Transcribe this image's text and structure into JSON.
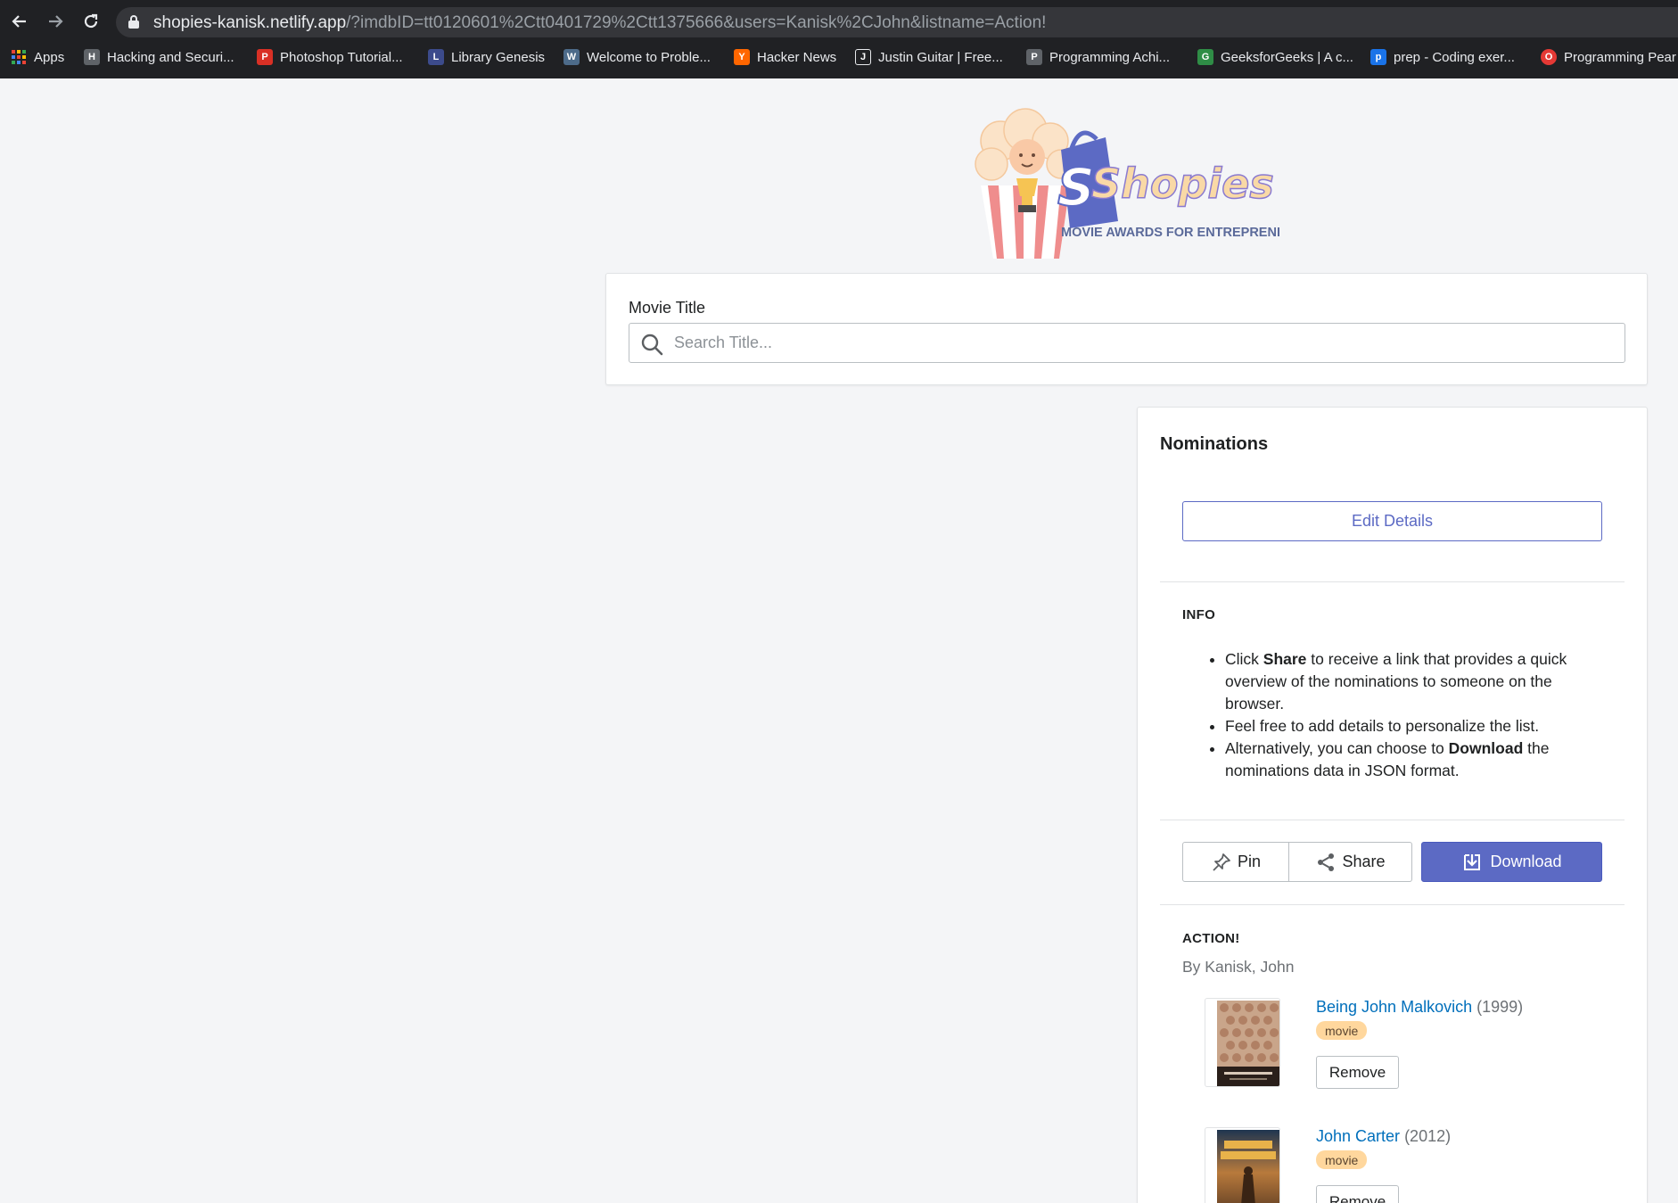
{
  "browser": {
    "url_host": "shopies-kanisk.netlify.app",
    "url_rest": "/?imdbID=tt0120601%2Ctt0401729%2Ctt1375666&users=Kanisk%2CJohn&listname=Action!",
    "back_icon": "arrow-left-icon",
    "forward_icon": "arrow-right-icon",
    "reload_icon": "reload-icon",
    "bookmarks": [
      {
        "label": "Apps",
        "color": "#ea4335"
      },
      {
        "label": "Hacking and Securi...",
        "color": "#5f6368"
      },
      {
        "label": "Photoshop Tutorial...",
        "color": "#d93025"
      },
      {
        "label": "Library Genesis",
        "color": "#3c4b8c"
      },
      {
        "label": "Welcome to Proble...",
        "color": "#4d6b8a"
      },
      {
        "label": "Hacker News",
        "color": "#ff6600"
      },
      {
        "label": "Justin Guitar | Free...",
        "color": "#202124"
      },
      {
        "label": "Programming Achi...",
        "color": "#5f6368"
      },
      {
        "label": "GeeksforGeeks | A c...",
        "color": "#2f8d46"
      },
      {
        "label": "prep - Coding exer...",
        "color": "#1a73e8"
      },
      {
        "label": "Programming Pear",
        "color": "#e53935"
      }
    ]
  },
  "logo": {
    "brand": "Shopies",
    "tagline": "MOVIE AWARDS FOR ENTREPRENEURS"
  },
  "search": {
    "label": "Movie Title",
    "placeholder": "Search Title...",
    "value": ""
  },
  "nominations": {
    "title": "Nominations",
    "edit_label": "Edit Details",
    "info_heading": "INFO",
    "info_items": [
      {
        "pre": "Click ",
        "bold": "Share",
        "post": " to receive a link that provides a quick overview of the nominations to someone on the browser."
      },
      {
        "pre": "Feel free to add details to personalize the list.",
        "bold": "",
        "post": ""
      },
      {
        "pre": "Alternatively, you can choose to ",
        "bold": "Download",
        "post": " the nominations data in JSON format."
      }
    ],
    "pin_label": "Pin",
    "share_label": "Share",
    "download_label": "Download",
    "list_name": "ACTION!",
    "by_line": "By Kanisk, John",
    "movies": [
      {
        "title": "Being John Malkovich",
        "year": "(1999)",
        "type": "movie",
        "remove_label": "Remove"
      },
      {
        "title": "John Carter",
        "year": "(2012)",
        "type": "movie",
        "remove_label": "Remove"
      }
    ]
  },
  "colors": {
    "accent": "#5c6ac4",
    "link": "#006fbb",
    "badge_bg": "#ffd79d",
    "page_bg": "#f4f5f7"
  }
}
